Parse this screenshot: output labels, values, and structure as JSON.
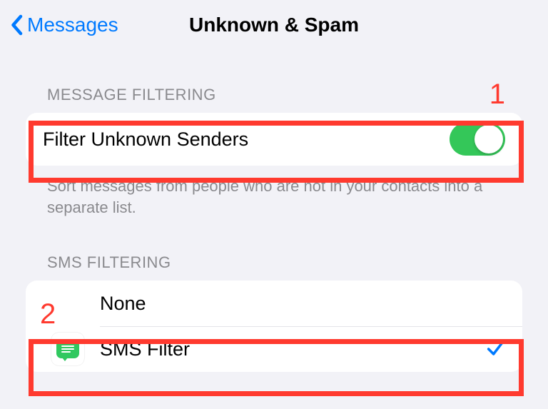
{
  "header": {
    "back_label": "Messages",
    "title": "Unknown & Spam"
  },
  "sections": {
    "message_filtering": {
      "header": "MESSAGE FILTERING",
      "row_label": "Filter Unknown Senders",
      "toggle_on": true,
      "footer": "Sort messages from people who are not in your contacts into a separate list."
    },
    "sms_filtering": {
      "header": "SMS FILTERING",
      "rows": [
        {
          "label": "None",
          "selected": false
        },
        {
          "label": "SMS Filter",
          "selected": true
        }
      ]
    }
  },
  "annotations": {
    "one": "1",
    "two": "2"
  }
}
